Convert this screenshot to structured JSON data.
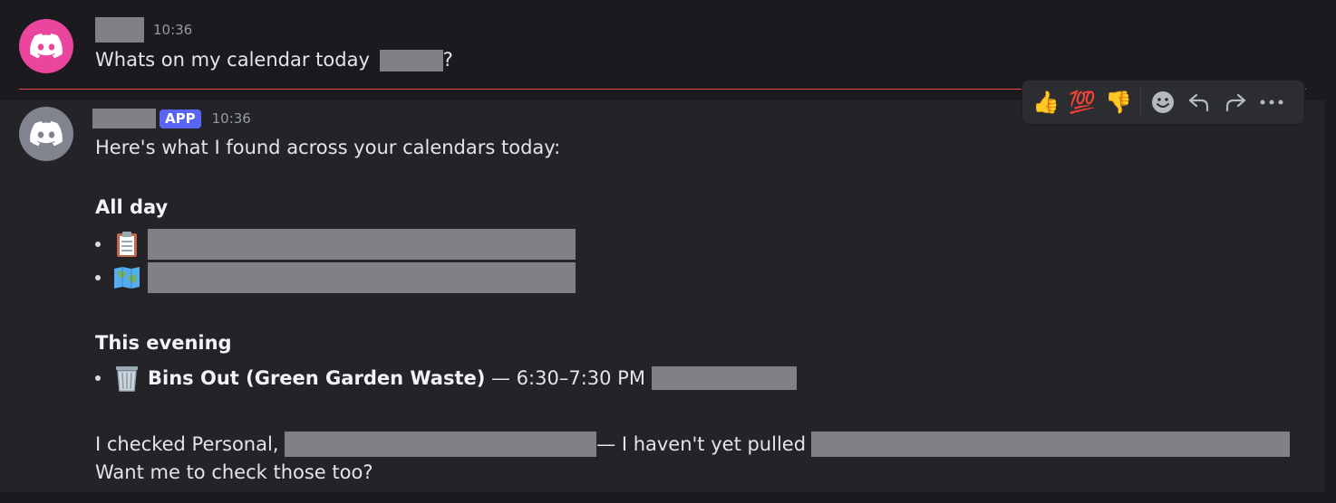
{
  "message1": {
    "time": "10:36",
    "text_before": "Whats on my calendar today",
    "text_after": "?"
  },
  "message2": {
    "badge": "APP",
    "time": "10:36",
    "intro": "Here's what I found across your calendars today:",
    "section_all_day": "All day",
    "all_day_items": [
      {
        "icon": "clipboard-icon"
      },
      {
        "icon": "map-icon"
      }
    ],
    "section_evening": "This evening",
    "evening_item": {
      "icon": "wastebasket-icon",
      "title": "Bins Out (Green Garden Waste)",
      "time_text": " — 6:30–7:30 PM "
    },
    "footer_line1_a": "I checked Personal, ",
    "footer_line1_b": "— I haven't yet pulled",
    "footer_line2": "Want me to check those too?"
  },
  "toolbar": {
    "reactions": [
      "👍",
      "💯",
      "👎"
    ],
    "icons": [
      "add-reaction-icon",
      "reply-icon",
      "forward-icon",
      "more-icon"
    ]
  },
  "colors": {
    "background": "#1b1b1f",
    "hover_background": "#232328",
    "app_badge": "#5865f2",
    "avatar_pink": "#eb459e",
    "avatar_grey": "#80848e",
    "new_divider": "#e5484d"
  }
}
